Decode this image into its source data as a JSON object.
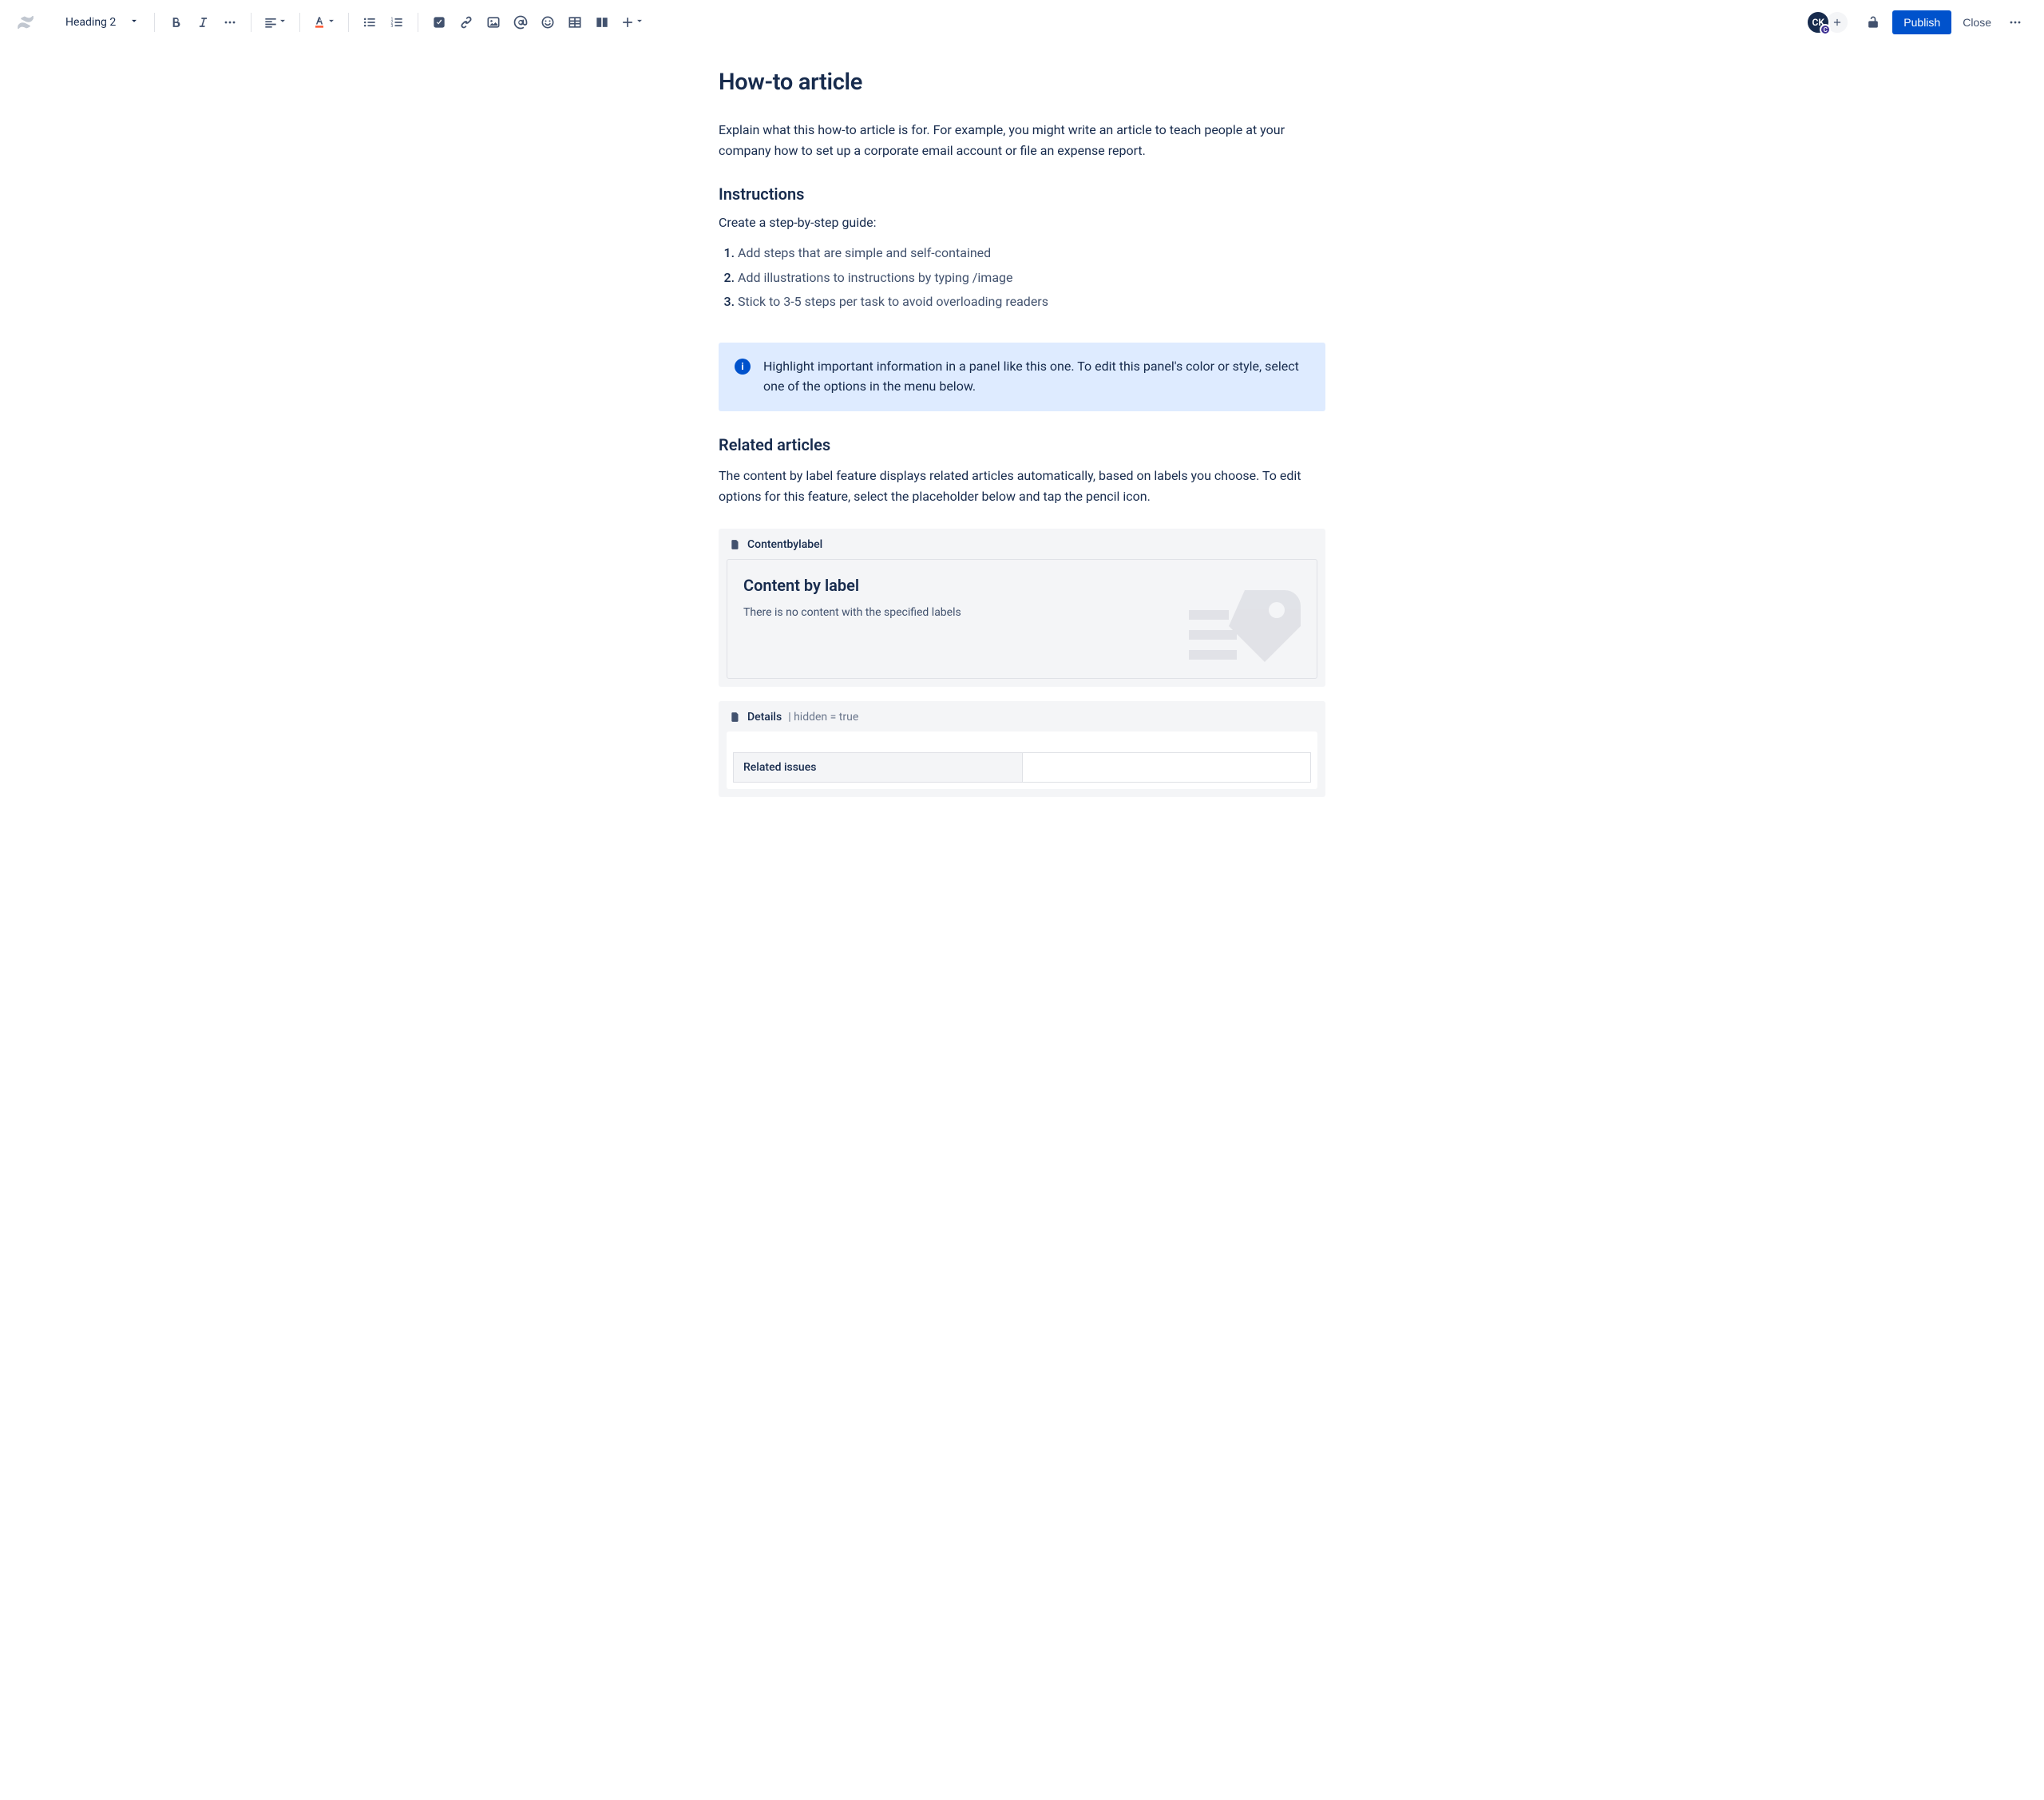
{
  "toolbar": {
    "heading_selector": "Heading 2",
    "publish_label": "Publish",
    "close_label": "Close"
  },
  "avatar": {
    "initials": "CK",
    "badge": "C"
  },
  "page": {
    "title": "How-to article",
    "intro": "Explain what this how-to article is for. For example, you might write an article to teach people at your company how to set up a corporate email account or file an expense report.",
    "instructions_heading": "Instructions",
    "instructions_sub": "Create a step-by-step guide:",
    "steps": [
      "Add steps that are simple and self-contained",
      "Add illustrations to instructions by typing /image",
      "Stick to 3-5 steps per task to avoid overloading readers"
    ],
    "info_panel": "Highlight important information in a panel like this one. To edit this panel's color or style, select one of the options in the menu below.",
    "related_heading": "Related articles",
    "related_desc": "The content by label feature displays related articles automatically, based on labels you choose. To edit options for this feature, select the placeholder below and tap the pencil icon."
  },
  "macros": {
    "content_by_label": {
      "header": "Contentbylabel",
      "title": "Content by label",
      "empty": "There is no content with the specified labels"
    },
    "details": {
      "header": "Details",
      "hidden_tag": "| hidden = true",
      "row_label": "Related issues",
      "row_value": ""
    }
  }
}
